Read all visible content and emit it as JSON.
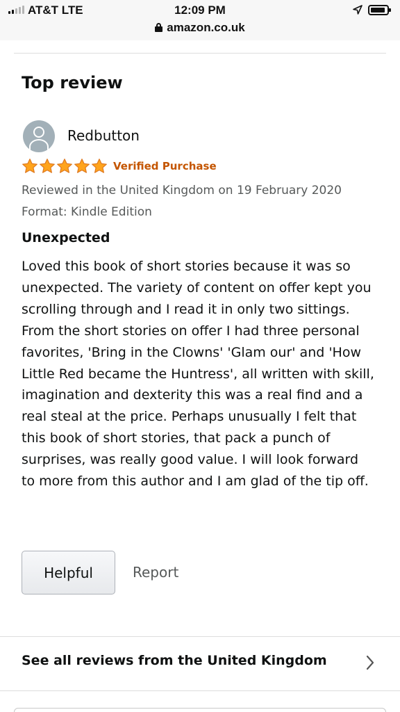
{
  "status_bar": {
    "carrier": "AT&T  LTE",
    "time": "12:09 PM",
    "url": "amazon.co.uk"
  },
  "section_title": "Top review",
  "review": {
    "reviewer": "Redbutton",
    "rating": 5,
    "rating_max": 5,
    "star_color": "#ffa41c",
    "badge": "Verified Purchase",
    "badge_color": "#c45500",
    "date_line": "Reviewed in the United Kingdom on 19 February 2020",
    "format_line": "Format: Kindle Edition",
    "title": "Unexpected",
    "body": "Loved this book of short stories because it was so unexpected. The variety of content on offer kept you scrolling through and I read it in only two sittings. From the short stories on offer I had three personal favorites, 'Bring in the Clowns' 'Glam our' and 'How Little Red became the Huntress', all written with skill, imagination and dexterity this was a real find and a real steal at the price. Perhaps unusually I felt that this book of short stories, that pack a punch of surprises, was really good value. I will look forward to more from this author and I am glad of the tip off."
  },
  "actions": {
    "helpful_label": "Helpful",
    "report_label": "Report"
  },
  "see_all": {
    "label": "See all reviews from the United Kingdom",
    "icon": "chevron-right-icon"
  }
}
